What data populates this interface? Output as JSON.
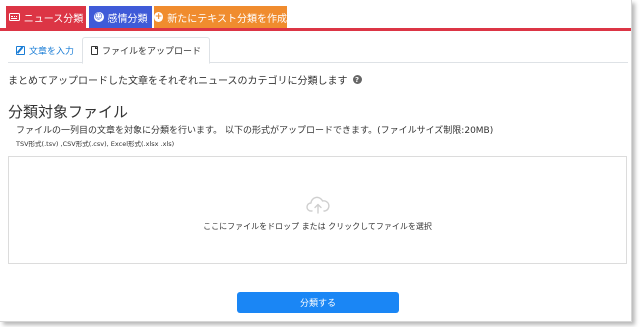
{
  "top_tabs": [
    {
      "label": "ニュース分類",
      "icon": "keyboard-icon",
      "color": "#dc3545"
    },
    {
      "label": "感情分類",
      "icon": "smile-icon",
      "color": "#3f5bd8"
    },
    {
      "label": "新たにテキスト分類を作成",
      "icon": "plus-circle-icon",
      "color": "#f08c2e"
    }
  ],
  "sub_tabs": [
    {
      "label": "文章を入力",
      "icon": "edit-icon",
      "active": false
    },
    {
      "label": "ファイルをアップロード",
      "icon": "file-icon",
      "active": true
    }
  ],
  "description": "まとめてアップロードした文章をそれぞれニュースのカテゴリに分類します",
  "section": {
    "title": "分類対象ファイル",
    "subtitle": "ファイルの一列目の文章を対象に分類を行います。 以下の形式がアップロードできます。(ファイルサイズ制限:20MB)",
    "formats": "TSV形式(.tsv) ,CSV形式(.csv), Excel形式(.xlsx .xls)"
  },
  "dropzone": {
    "text": "ここにファイルをドロップ または クリックしてファイルを選択",
    "icon": "cloud-upload-icon"
  },
  "submit_label": "分類する",
  "colors": {
    "accent_red": "#dc3545",
    "accent_blue": "#3f5bd8",
    "accent_orange": "#f08c2e",
    "link_blue": "#1a7dd6",
    "button_blue": "#1a86f5"
  }
}
